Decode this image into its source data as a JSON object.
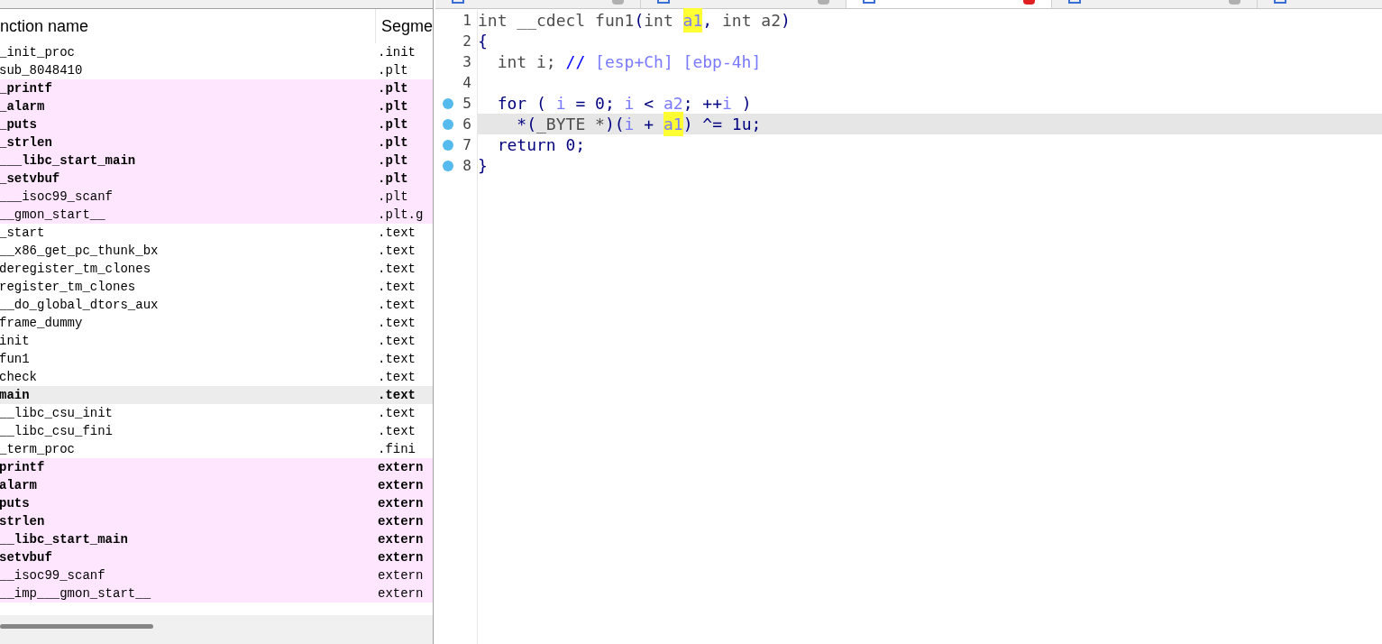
{
  "functions_panel": {
    "columns": [
      "nction name",
      "Segme"
    ],
    "rows": [
      {
        "name": "_init_proc",
        "segment": ".init",
        "bold": false,
        "highlighted": false,
        "selected": false
      },
      {
        "name": "sub_8048410",
        "segment": ".plt",
        "bold": false,
        "highlighted": false,
        "selected": false
      },
      {
        "name": "_printf",
        "segment": ".plt",
        "bold": true,
        "highlighted": true,
        "selected": false
      },
      {
        "name": "_alarm",
        "segment": ".plt",
        "bold": true,
        "highlighted": true,
        "selected": false
      },
      {
        "name": "_puts",
        "segment": ".plt",
        "bold": true,
        "highlighted": true,
        "selected": false
      },
      {
        "name": "_strlen",
        "segment": ".plt",
        "bold": true,
        "highlighted": true,
        "selected": false
      },
      {
        "name": "___libc_start_main",
        "segment": ".plt",
        "bold": true,
        "highlighted": true,
        "selected": false
      },
      {
        "name": "_setvbuf",
        "segment": ".plt",
        "bold": true,
        "highlighted": true,
        "selected": false
      },
      {
        "name": "___isoc99_scanf",
        "segment": ".plt",
        "bold": false,
        "highlighted": true,
        "selected": false
      },
      {
        "name": "__gmon_start__",
        "segment": ".plt.g",
        "bold": false,
        "highlighted": true,
        "selected": false
      },
      {
        "name": "_start",
        "segment": ".text",
        "bold": false,
        "highlighted": false,
        "selected": false
      },
      {
        "name": "__x86_get_pc_thunk_bx",
        "segment": ".text",
        "bold": false,
        "highlighted": false,
        "selected": false
      },
      {
        "name": "deregister_tm_clones",
        "segment": ".text",
        "bold": false,
        "highlighted": false,
        "selected": false
      },
      {
        "name": "register_tm_clones",
        "segment": ".text",
        "bold": false,
        "highlighted": false,
        "selected": false
      },
      {
        "name": "__do_global_dtors_aux",
        "segment": ".text",
        "bold": false,
        "highlighted": false,
        "selected": false
      },
      {
        "name": "frame_dummy",
        "segment": ".text",
        "bold": false,
        "highlighted": false,
        "selected": false
      },
      {
        "name": "init",
        "segment": ".text",
        "bold": false,
        "highlighted": false,
        "selected": false
      },
      {
        "name": "fun1",
        "segment": ".text",
        "bold": false,
        "highlighted": false,
        "selected": false
      },
      {
        "name": "check",
        "segment": ".text",
        "bold": false,
        "highlighted": false,
        "selected": false
      },
      {
        "name": "main",
        "segment": ".text",
        "bold": true,
        "highlighted": false,
        "selected": true
      },
      {
        "name": "__libc_csu_init",
        "segment": ".text",
        "bold": false,
        "highlighted": false,
        "selected": false
      },
      {
        "name": "__libc_csu_fini",
        "segment": ".text",
        "bold": false,
        "highlighted": false,
        "selected": false
      },
      {
        "name": "_term_proc",
        "segment": ".fini",
        "bold": false,
        "highlighted": false,
        "selected": false
      },
      {
        "name": "printf",
        "segment": "extern",
        "bold": true,
        "highlighted": true,
        "selected": false
      },
      {
        "name": "alarm",
        "segment": "extern",
        "bold": true,
        "highlighted": true,
        "selected": false
      },
      {
        "name": "puts",
        "segment": "extern",
        "bold": true,
        "highlighted": true,
        "selected": false
      },
      {
        "name": "strlen",
        "segment": "extern",
        "bold": true,
        "highlighted": true,
        "selected": false
      },
      {
        "name": "__libc_start_main",
        "segment": "extern",
        "bold": true,
        "highlighted": true,
        "selected": false
      },
      {
        "name": "setvbuf",
        "segment": "extern",
        "bold": true,
        "highlighted": true,
        "selected": false
      },
      {
        "name": "__isoc99_scanf",
        "segment": "extern",
        "bold": false,
        "highlighted": true,
        "selected": false
      },
      {
        "name": "__imp___gmon_start__",
        "segment": "extern",
        "bold": false,
        "highlighted": true,
        "selected": false
      }
    ]
  },
  "tabs": [
    {
      "selected": false
    },
    {
      "selected": false
    },
    {
      "selected": true
    },
    {
      "selected": false
    },
    {
      "selected": false
    }
  ],
  "pseudocode": {
    "lines": [
      {
        "number": "1",
        "breakpoint": false,
        "current": false,
        "tokens": [
          {
            "text": "int __cdecl fun1",
            "kind": "type"
          },
          {
            "text": "(",
            "kind": "keyword"
          },
          {
            "text": "int ",
            "kind": "type"
          },
          {
            "text": "a1",
            "kind": "highlight"
          },
          {
            "text": ", ",
            "kind": "keyword"
          },
          {
            "text": "int a2",
            "kind": "type"
          },
          {
            "text": ")",
            "kind": "keyword"
          }
        ]
      },
      {
        "number": "2",
        "breakpoint": false,
        "current": false,
        "tokens": [
          {
            "text": "{",
            "kind": "keyword"
          }
        ]
      },
      {
        "number": "3",
        "breakpoint": false,
        "current": false,
        "tokens": [
          {
            "text": "  int i; ",
            "kind": "type"
          },
          {
            "text": "// ",
            "kind": "comment"
          },
          {
            "text": "[esp+Ch] [ebp-4h]",
            "kind": "var"
          }
        ]
      },
      {
        "number": "4",
        "breakpoint": false,
        "current": false
      },
      {
        "number": "5",
        "breakpoint": true,
        "current": false,
        "tokens": [
          {
            "text": "  for ( ",
            "kind": "keyword"
          },
          {
            "text": "i",
            "kind": "var"
          },
          {
            "text": " = 0; ",
            "kind": "keyword"
          },
          {
            "text": "i",
            "kind": "var"
          },
          {
            "text": " < ",
            "kind": "keyword"
          },
          {
            "text": "a2",
            "kind": "var"
          },
          {
            "text": "; ++",
            "kind": "keyword"
          },
          {
            "text": "i",
            "kind": "var"
          },
          {
            "text": " )",
            "kind": "keyword"
          }
        ]
      },
      {
        "number": "6",
        "breakpoint": true,
        "current": true,
        "tokens": [
          {
            "text": "    *(",
            "kind": "keyword"
          },
          {
            "text": "_BYTE *",
            "kind": "type"
          },
          {
            "text": ")(",
            "kind": "keyword"
          },
          {
            "text": "i",
            "kind": "var"
          },
          {
            "text": " + ",
            "kind": "keyword"
          },
          {
            "text": "a1",
            "kind": "highlight"
          },
          {
            "text": ") ^= 1u;",
            "kind": "keyword"
          }
        ]
      },
      {
        "number": "7",
        "breakpoint": true,
        "current": false,
        "tokens": [
          {
            "text": "  return 0;",
            "kind": "keyword"
          }
        ]
      },
      {
        "number": "8",
        "breakpoint": true,
        "current": false,
        "tokens": [
          {
            "text": "}",
            "kind": "keyword"
          }
        ]
      }
    ]
  }
}
